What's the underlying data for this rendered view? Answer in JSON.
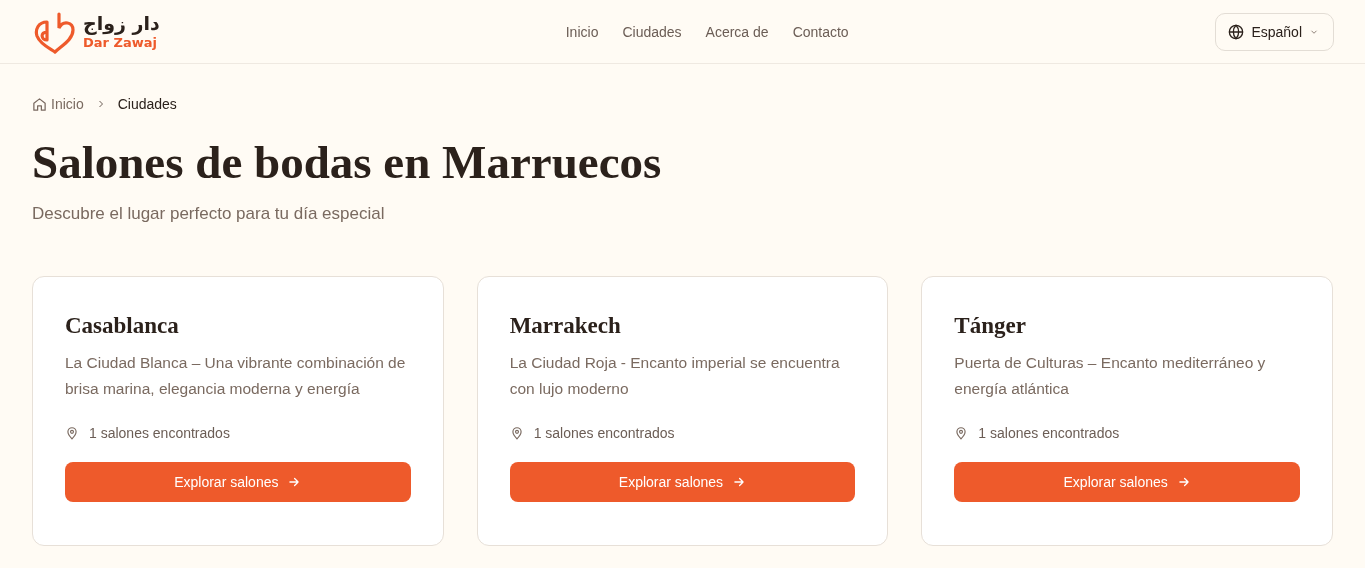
{
  "header": {
    "logo": {
      "arabic": "دار زواج",
      "latin": "Dar Zawaj"
    },
    "nav": [
      {
        "label": "Inicio"
      },
      {
        "label": "Ciudades"
      },
      {
        "label": "Acerca de"
      },
      {
        "label": "Contacto"
      }
    ],
    "language": "Español"
  },
  "breadcrumb": [
    {
      "label": "Inicio",
      "kind": "home"
    },
    {
      "label": "Ciudades",
      "kind": "current"
    }
  ],
  "title": "Salones de bodas en Marruecos",
  "subtitle": "Descubre el lugar perfecto para tu día especial",
  "cities": [
    {
      "name": "Casablanca",
      "description": "La Ciudad Blanca – Una vibrante combinación de brisa marina, elegancia moderna y energía",
      "count": "1 salones encontrados",
      "button": "Explorar salones"
    },
    {
      "name": "Marrakech",
      "description": "La Ciudad Roja - Encanto imperial se encuentra con lujo moderno",
      "count": "1 salones encontrados",
      "button": "Explorar salones"
    },
    {
      "name": "Tánger",
      "description": "Puerta de Culturas – Encanto mediterráneo y energía atlántica",
      "count": "1 salones encontrados",
      "button": "Explorar salones"
    }
  ]
}
